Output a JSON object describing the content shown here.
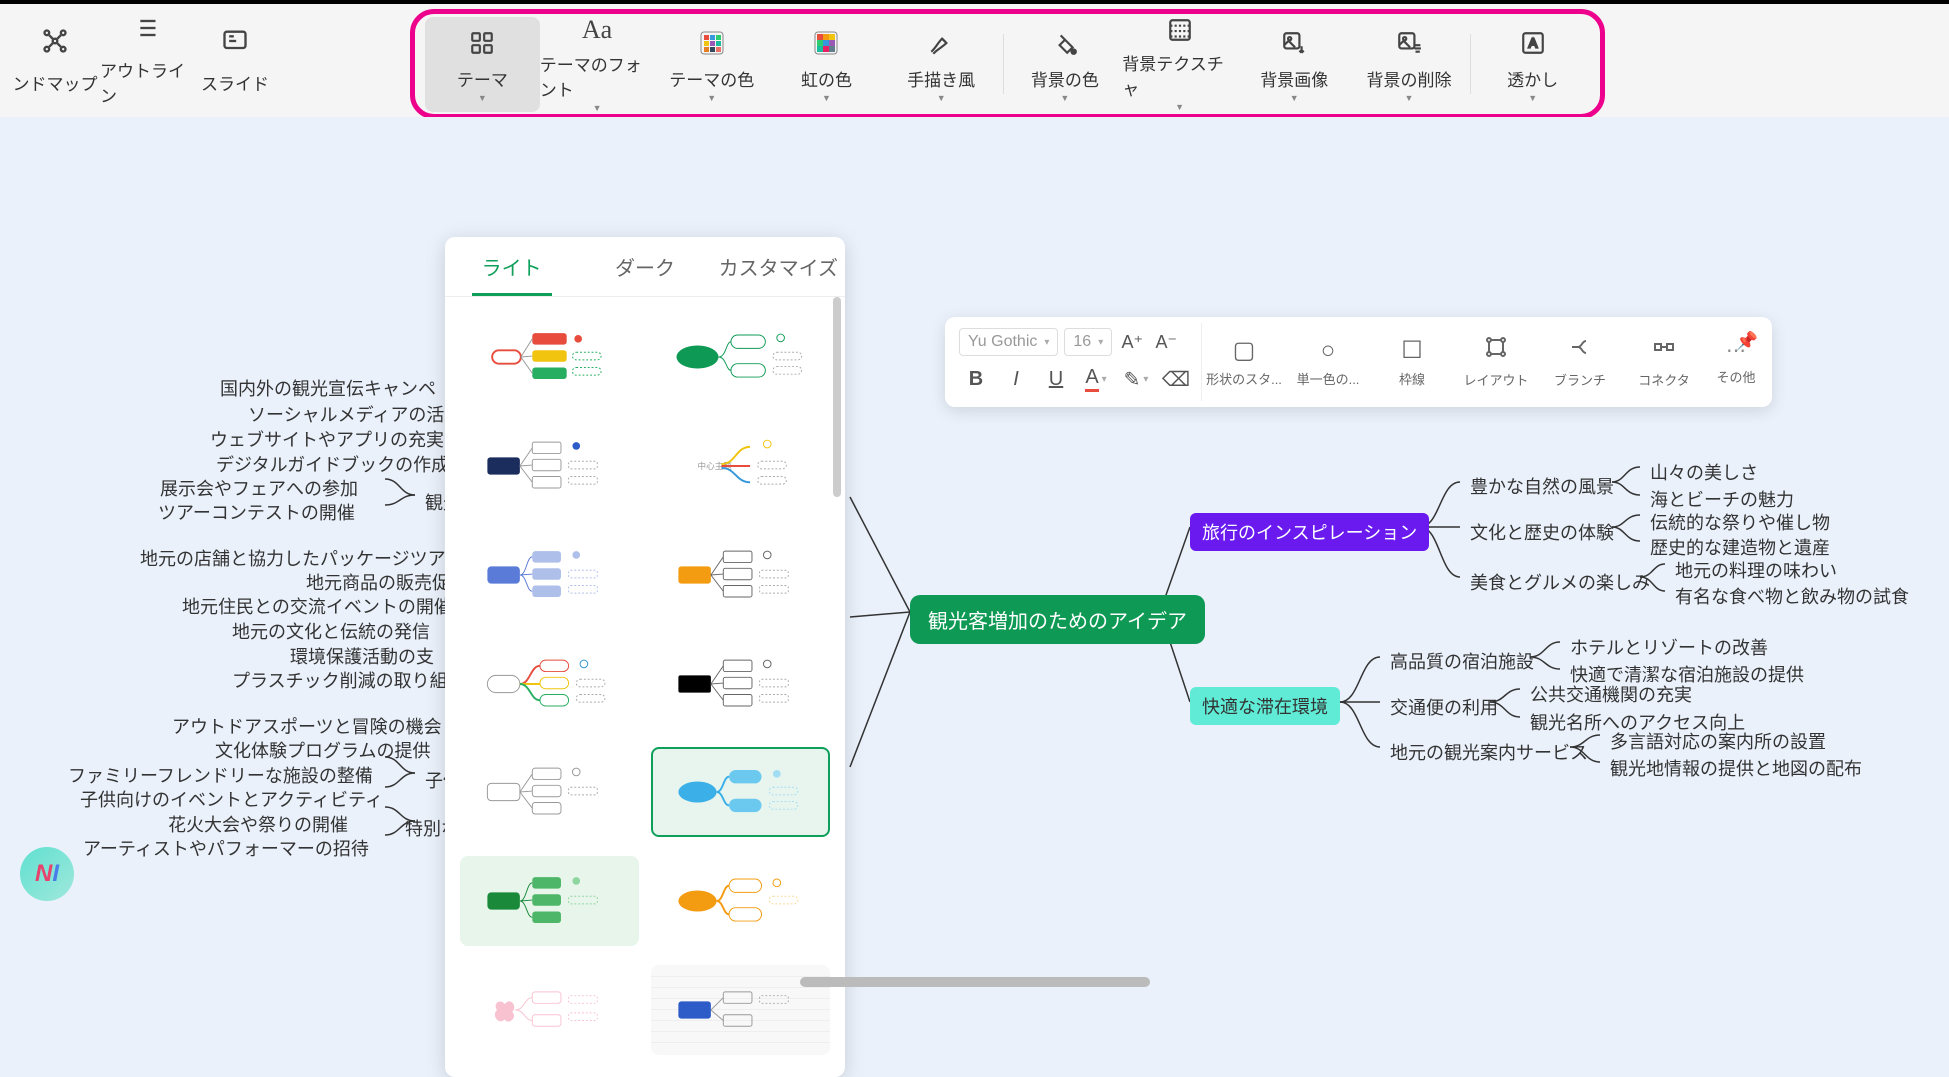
{
  "left_tools": {
    "mindmap": "ンドマップ",
    "outline": "アウトライン",
    "slide": "スライド"
  },
  "ribbon": {
    "theme": "テーマ",
    "theme_font": "テーマのフォント",
    "theme_color": "テーマの色",
    "rainbow": "虹の色",
    "handdrawn": "手描き風",
    "bg_color": "背景の色",
    "bg_texture": "背景テクスチャ",
    "bg_image": "背景画像",
    "bg_delete": "背景の削除",
    "watermark": "透かし"
  },
  "theme_panel": {
    "tab_light": "ライト",
    "tab_dark": "ダーク",
    "tab_custom": "カスタマイズ"
  },
  "float_toolbar": {
    "font_family": "Yu Gothic",
    "font_size": "16",
    "shape_style": "形状のスタ...",
    "mono": "単一色の...",
    "outline": "枠線",
    "layout": "レイアウト",
    "branch": "ブランチ",
    "connector": "コネクタ",
    "other": "その他"
  },
  "mindmap": {
    "center": "観光客増加のためのアイデア",
    "right_main1": "旅行のインスピレーション",
    "right_main2": "快適な滞在環境",
    "r1_a": "豊かな自然の風景",
    "r1_a1": "山々の美しさ",
    "r1_a2": "海とビーチの魅力",
    "r1_b": "文化と歴史の体験",
    "r1_b1": "伝統的な祭りや催し物",
    "r1_b2": "歴史的な建造物と遺産",
    "r1_c": "美食とグルメの楽しみ",
    "r1_c1": "地元の料理の味わい",
    "r1_c2": "有名な食べ物と飲み物の試食",
    "r2_a": "高品質の宿泊施設",
    "r2_a1": "ホテルとリゾートの改善",
    "r2_a2": "快適で清潔な宿泊施設の提供",
    "r2_b": "交通便の利用",
    "r2_b1": "公共交通機関の充実",
    "r2_b2": "観光名所へのアクセス向上",
    "r2_c": "地元の観光案内サービス",
    "r2_c1": "多言語対応の案内所の設置",
    "r2_c2": "観光地情報の提供と地図の配布",
    "left_group1_label": "観光",
    "l1_1": "国内外の観光宣伝キャンペ",
    "l1_2": "ソーシャルメディアの活",
    "l1_3": "ウェブサイトやアプリの充実",
    "l1_4": "デジタルガイドブックの作成",
    "l1_5": "展示会やフェアへの参加",
    "l1_6": "ツアーコンテストの開催",
    "l2_1": "地元の店舗と協力したパッケージツア",
    "l2_2": "地元商品の販売促",
    "l2_3": "地元住民との交流イベントの開催",
    "l2_4": "地元の文化と伝統の発信",
    "l2_5": "環境保護活動の支",
    "l2_6": "プラスチック削減の取り組",
    "l3_1": "アウトドアスポーツと冒険の機会",
    "l3_2": "文化体験プログラムの提供",
    "l3_3": "ファミリーフレンドリーな施設の整備",
    "l3_4": "子供向けのイベントとアクティビティ",
    "l3_5": "花火大会や祭りの開催",
    "l3_6": "アーティストやパフォーマーの招待",
    "l3_label1": "子供",
    "l3_label2": "特別な"
  }
}
